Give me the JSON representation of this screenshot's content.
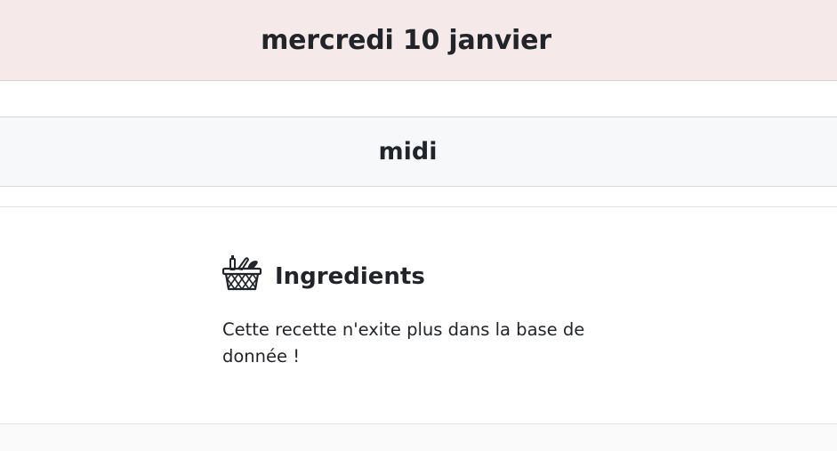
{
  "day": {
    "title": "mercredi 10 janvier"
  },
  "meal": {
    "title": "midi"
  },
  "ingredients": {
    "title": "Ingredients",
    "icon": "basket-icon",
    "message": "Cette recette n'exite plus dans la base de donnée !"
  },
  "colors": {
    "day_header_bg": "#f5e9ea",
    "meal_header_bg": "#f7f8fa",
    "text": "#212529"
  }
}
